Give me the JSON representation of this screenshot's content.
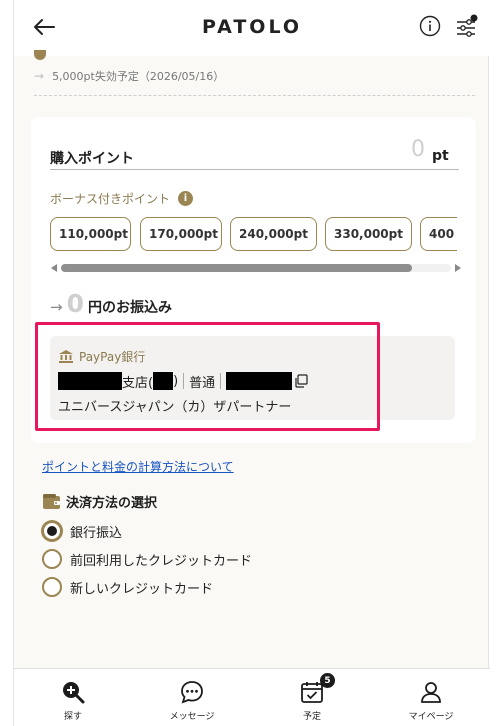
{
  "header": {
    "title": "PATOLO"
  },
  "expiry": {
    "text": "5,000pt失効予定（2026/05/16）"
  },
  "purchase": {
    "label": "購入ポイント",
    "value": "0",
    "unit": "pt",
    "bonus_label": "ボーナス付きポイント",
    "bonus_info": "i",
    "options": [
      "110,000pt",
      "170,000pt",
      "240,000pt",
      "330,000pt",
      "400"
    ],
    "scroll_position": 0.9
  },
  "transfer": {
    "amount": "0",
    "label": "円のお振込み"
  },
  "bank": {
    "name": "PayPay銀行",
    "branch_suffix": "支店(",
    "branch_close": ")",
    "account_type": "普通",
    "account_holder": "ユニバースジャパン（カ）ザパートナー"
  },
  "links": {
    "calculation": "ポイントと料金の計算方法について"
  },
  "payment": {
    "title": "決済方法の選択",
    "options": [
      {
        "label": "銀行振込",
        "selected": true
      },
      {
        "label": "前回利用したクレジットカード",
        "selected": false
      },
      {
        "label": "新しいクレジットカード",
        "selected": false
      }
    ]
  },
  "nav": {
    "items": [
      {
        "label": "探す",
        "icon": "search-plus-icon"
      },
      {
        "label": "メッセージ",
        "icon": "chat-icon"
      },
      {
        "label": "予定",
        "icon": "calendar-check-icon",
        "badge": "5"
      },
      {
        "label": "マイページ",
        "icon": "user-icon"
      }
    ]
  },
  "colors": {
    "accent": "#9b8653",
    "highlight": "#e8175d",
    "link": "#1a55c4"
  }
}
